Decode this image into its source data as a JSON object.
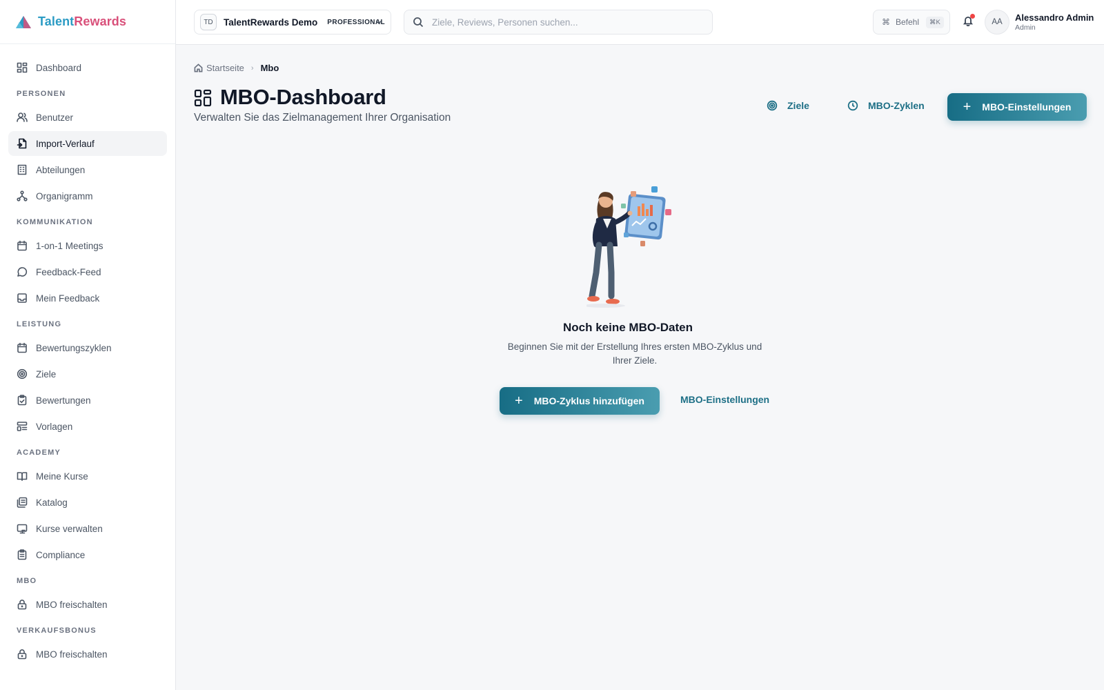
{
  "brand": {
    "name_part1": "Talent",
    "name_part2": "Rewards"
  },
  "sidebar": {
    "dashboard": {
      "label": "Dashboard",
      "icon": "dashboard-icon"
    },
    "sections": {
      "personen": "PERSONEN",
      "kommunikation": "KOMMUNIKATION",
      "leistung": "LEISTUNG",
      "academy": "ACADEMY",
      "mbo": "MBO",
      "verkaufsbonus": "VERKAUFSBONUS"
    },
    "items": {
      "benutzer": "Benutzer",
      "import_verlauf": "Import-Verlauf",
      "abteilungen": "Abteilungen",
      "organigramm": "Organigramm",
      "meetings": "1-on-1 Meetings",
      "feedback_feed": "Feedback-Feed",
      "mein_feedback": "Mein Feedback",
      "bewertungszyklen": "Bewertungszyklen",
      "ziele": "Ziele",
      "bewertungen": "Bewertungen",
      "vorlagen": "Vorlagen",
      "meine_kurse": "Meine Kurse",
      "katalog": "Katalog",
      "kurse_verwalten": "Kurse verwalten",
      "compliance": "Compliance",
      "mbo_freischalten": "MBO freischalten",
      "bonus_freischalten": "MBO freischalten"
    },
    "active_item": "Import-Verlauf"
  },
  "header": {
    "org_initials": "TD",
    "org_name": "TalentRewards Demo",
    "org_plan": "PROFESSIONAL",
    "search_placeholder": "Ziele, Reviews, Personen suchen...",
    "command_label": "Befehl",
    "command_shortcut": "⌘K",
    "user_initials": "AA",
    "user_name": "Alessandro Admin",
    "user_role": "Admin",
    "notification_dot_color": "#ef4444"
  },
  "main": {
    "breadcrumb": {
      "home": "Startseite",
      "current": "Mbo"
    },
    "title": "MBO-Dashboard",
    "subtitle": "Verwalten Sie das Zielmanagement Ihrer Organisation",
    "actions": {
      "ziele": "Ziele",
      "zyklen": "MBO-Zyklen",
      "einstellungen": "MBO-Einstellungen"
    },
    "empty_state": {
      "title": "Noch keine MBO-Daten",
      "description": "Beginnen Sie mit der Erstellung Ihres ersten MBO-Zyklus und Ihrer Ziele.",
      "primary_action": "MBO-Zyklus hinzufügen",
      "secondary_action": "MBO-Einstellungen"
    }
  },
  "colors": {
    "accent": "#1d6f86",
    "brand_blue": "#2b9bc4",
    "brand_pink": "#d9507a"
  }
}
